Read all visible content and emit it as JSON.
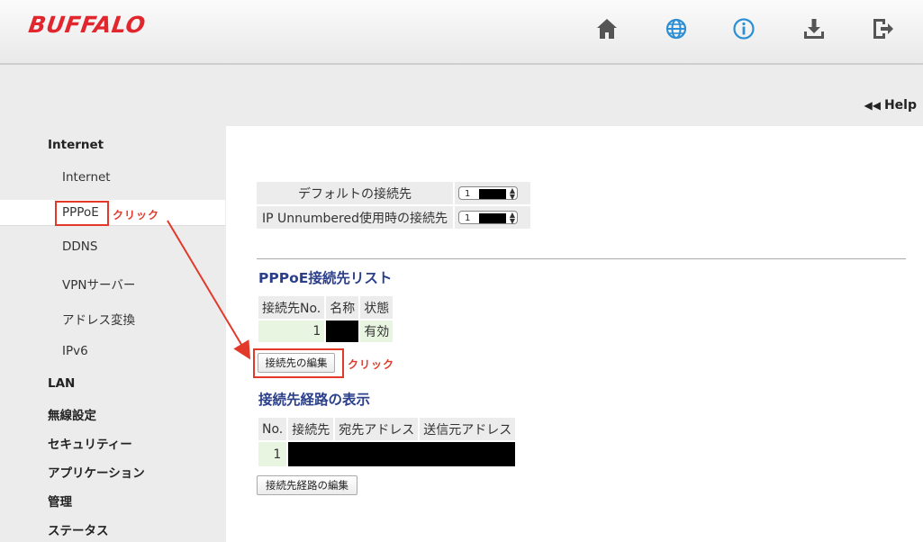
{
  "brand": "BUFFALO",
  "header_icons": [
    "home-icon",
    "globe-icon",
    "info-icon",
    "download-icon",
    "logout-icon"
  ],
  "help": {
    "arrows": "◀◀",
    "label": "Help"
  },
  "sidebar": {
    "group_internet": "Internet",
    "items": [
      "Internet",
      "PPPoE",
      "DDNS",
      "VPNサーバー",
      "アドレス変換",
      "IPv6"
    ],
    "groups": [
      "LAN",
      "無線設定",
      "セキュリティー",
      "アプリケーション",
      "管理",
      "ステータス"
    ]
  },
  "annotations": {
    "click1": "クリック",
    "click2": "クリック"
  },
  "default_table": {
    "rows": [
      {
        "label": "デフォルトの接続先",
        "value": "1"
      },
      {
        "label": "IP Unnumbered使用時の接続先",
        "value": "1"
      }
    ]
  },
  "pppoe_list": {
    "title": "PPPoE接続先リスト",
    "headers": [
      "接続先No.",
      "名称",
      "状態"
    ],
    "row": {
      "no": "1",
      "name": "",
      "status": "有効"
    },
    "edit_button": "接続先の編集"
  },
  "route_list": {
    "title": "接続先経路の表示",
    "headers": [
      "No.",
      "接続先",
      "宛先アドレス",
      "送信元アドレス"
    ],
    "row": {
      "no": "1"
    },
    "edit_button": "接続先経路の編集"
  },
  "colors": {
    "brand": "#e1262d",
    "accent": "#2b3f8a",
    "annotation": "#e2392b",
    "row_green": "#e8f5e0"
  }
}
